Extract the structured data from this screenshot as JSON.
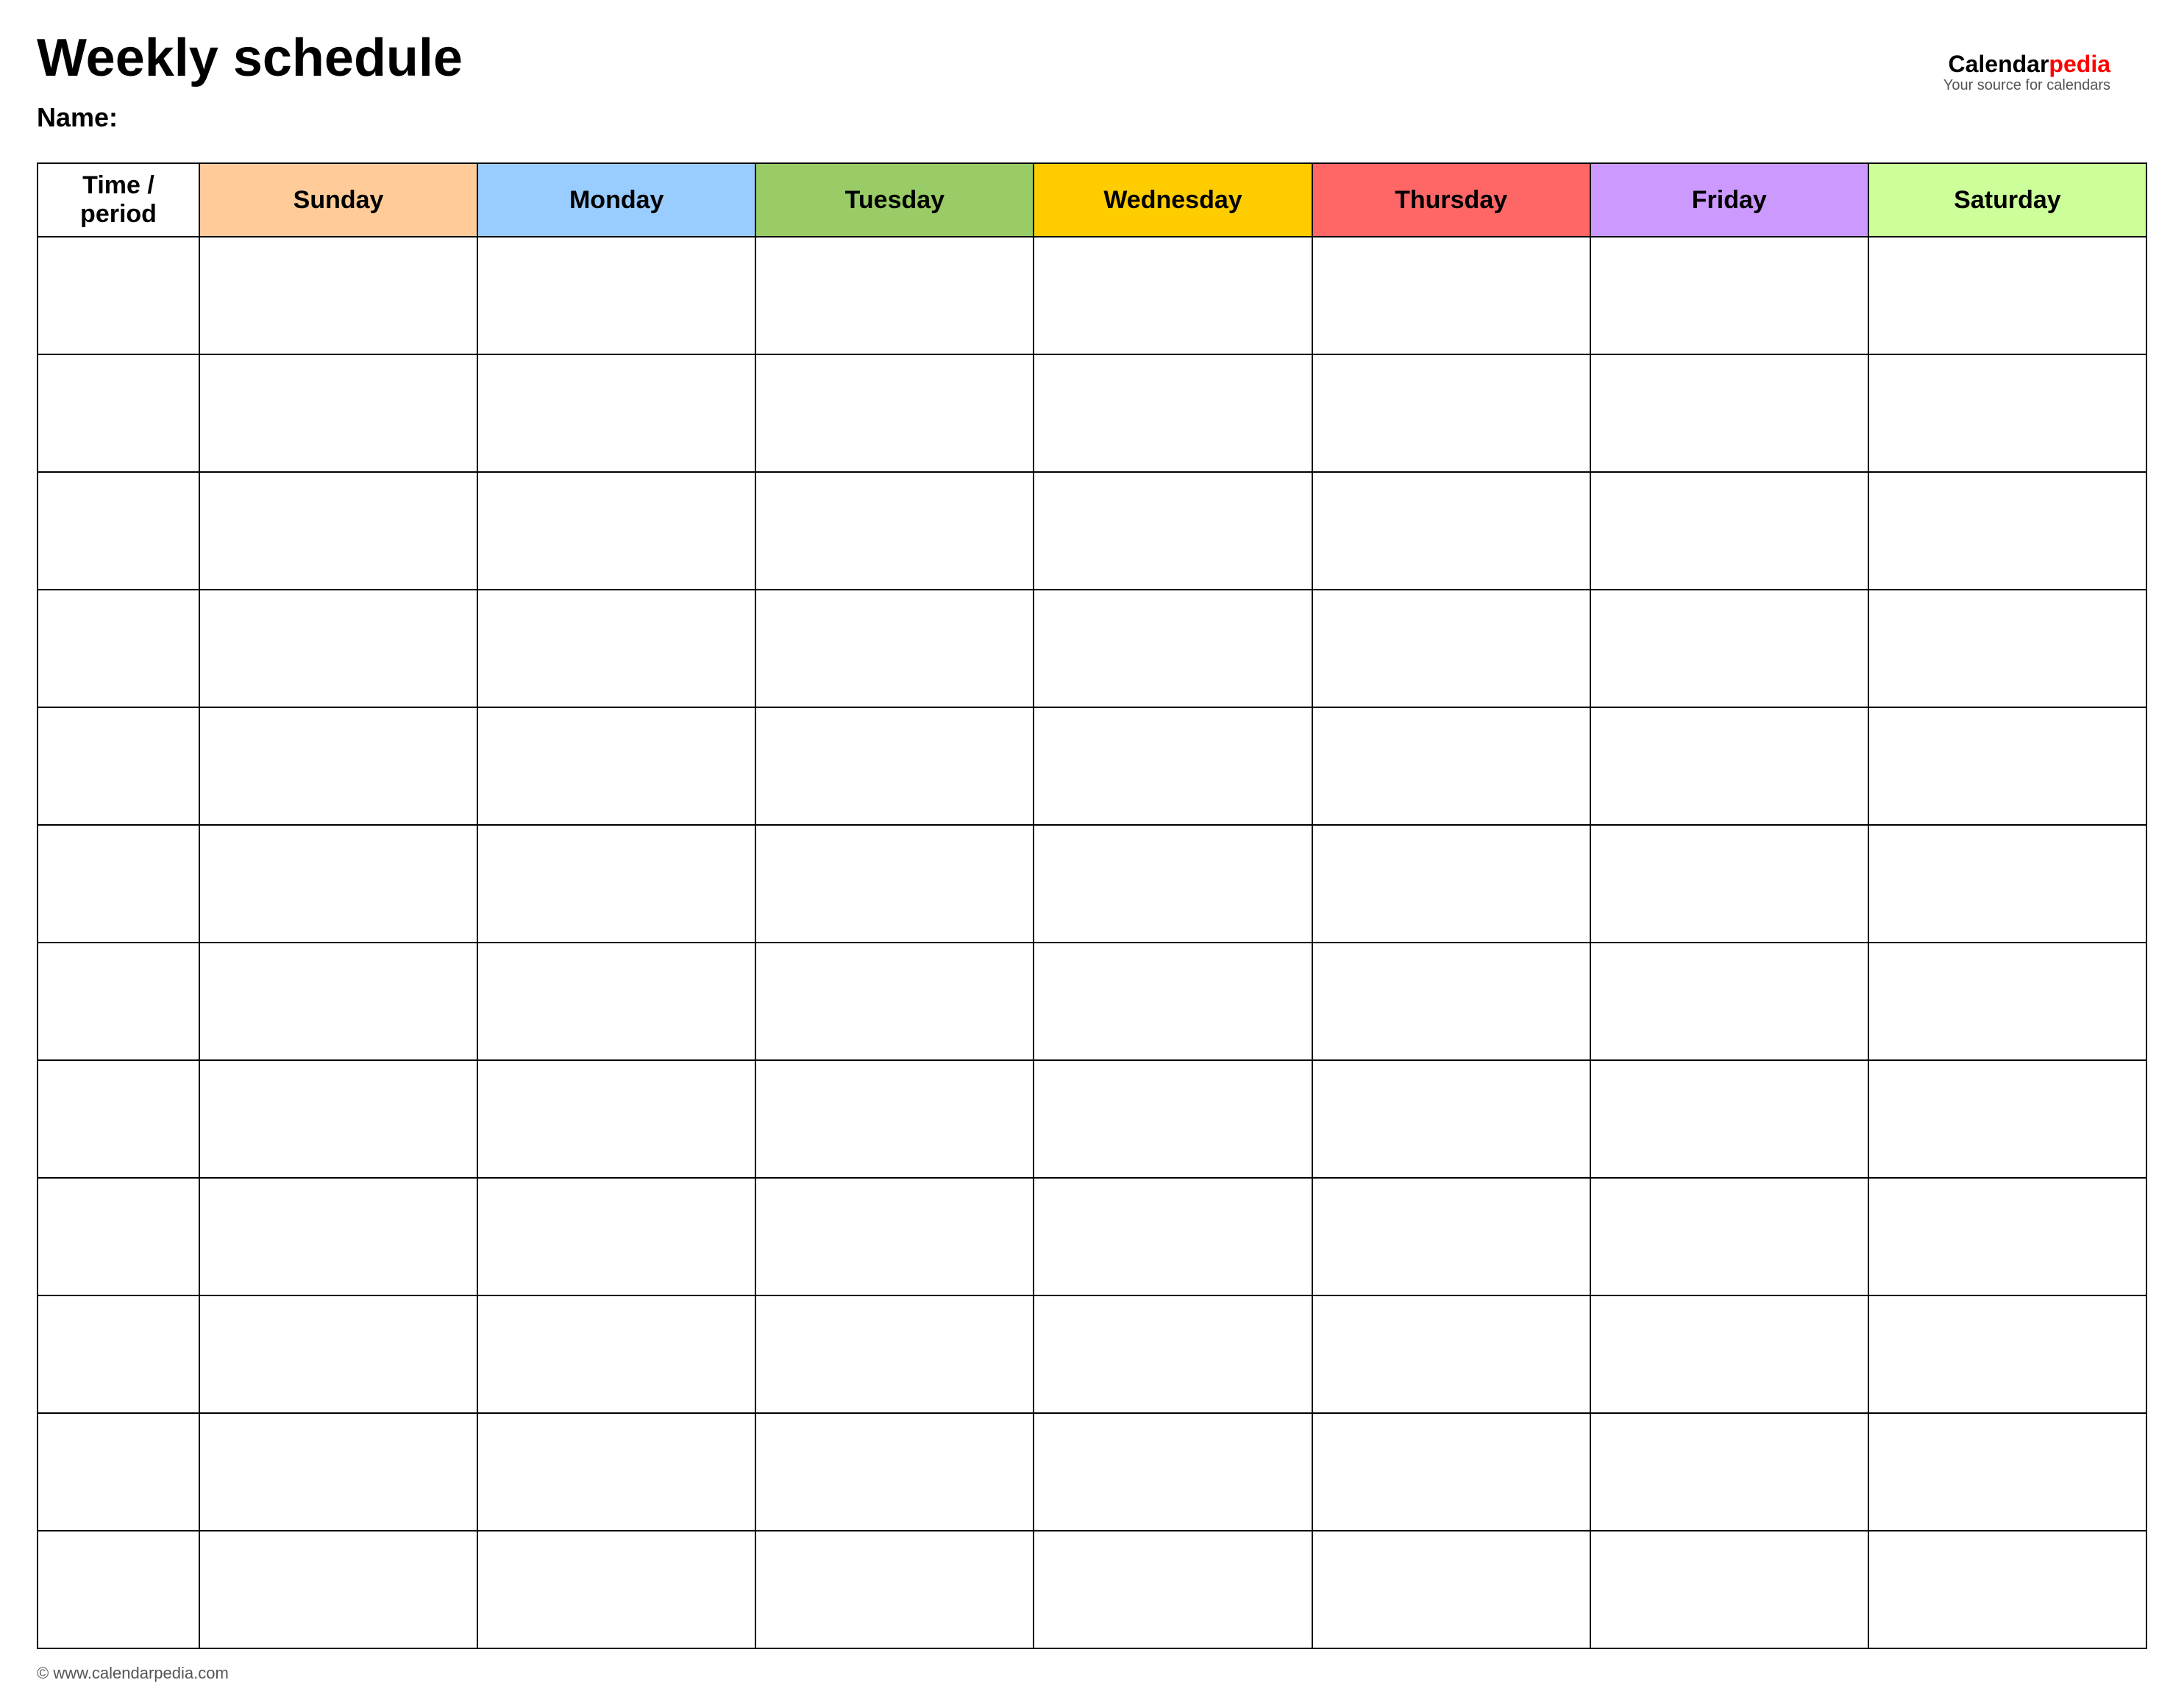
{
  "page": {
    "title": "Weekly schedule",
    "name_label": "Name:",
    "footer": "© www.calendarpedia.com"
  },
  "logo": {
    "brand_part1": "Calendar",
    "brand_part2": "pedia",
    "tagline": "Your source for calendars"
  },
  "table": {
    "headers": [
      {
        "id": "time",
        "label": "Time / period",
        "color_class": "header-time"
      },
      {
        "id": "sunday",
        "label": "Sunday",
        "color_class": "header-sunday"
      },
      {
        "id": "monday",
        "label": "Monday",
        "color_class": "header-monday"
      },
      {
        "id": "tuesday",
        "label": "Tuesday",
        "color_class": "header-tuesday"
      },
      {
        "id": "wednesday",
        "label": "Wednesday",
        "color_class": "header-wednesday"
      },
      {
        "id": "thursday",
        "label": "Thursday",
        "color_class": "header-thursday"
      },
      {
        "id": "friday",
        "label": "Friday",
        "color_class": "header-friday"
      },
      {
        "id": "saturday",
        "label": "Saturday",
        "color_class": "header-saturday"
      }
    ],
    "row_count": 12
  }
}
